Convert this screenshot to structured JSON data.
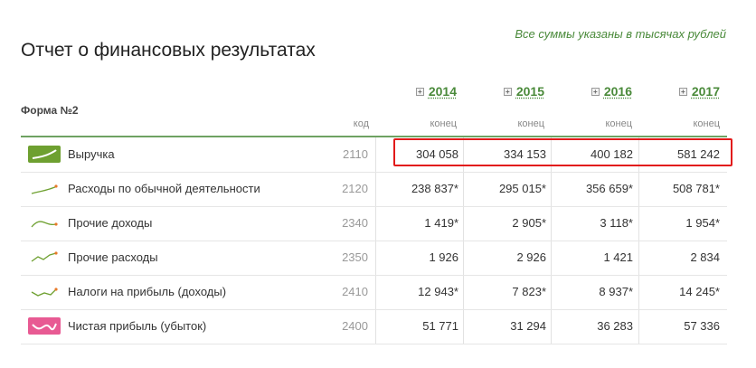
{
  "note": "Все суммы указаны в тысячах рублей",
  "title": "Отчет о финансовых результатах",
  "form_label": "Форма №2",
  "code_header": "код",
  "years": [
    {
      "label": "2014",
      "sub": "конец"
    },
    {
      "label": "2015",
      "sub": "конец"
    },
    {
      "label": "2016",
      "sub": "конец"
    },
    {
      "label": "2017",
      "sub": "конец"
    }
  ],
  "rows": [
    {
      "icon": "trend-chart-icon",
      "label": "Выручка",
      "code": "2110",
      "values": [
        "304 058",
        "334 153",
        "400 182",
        "581 242"
      ]
    },
    {
      "icon": "trend-line-icon",
      "label": "Расходы по обычной деятельности",
      "code": "2120",
      "values": [
        "238 837*",
        "295 015*",
        "356 659*",
        "508 781*"
      ]
    },
    {
      "icon": "trend-line-icon",
      "label": "Прочие доходы",
      "code": "2340",
      "values": [
        "1 419*",
        "2 905*",
        "3 118*",
        "1 954*"
      ]
    },
    {
      "icon": "trend-line-icon",
      "label": "Прочие расходы",
      "code": "2350",
      "values": [
        "1 926",
        "2 926",
        "1 421",
        "2 834"
      ]
    },
    {
      "icon": "trend-line-icon",
      "label": "Налоги на прибыль (доходы)",
      "code": "2410",
      "values": [
        "12 943*",
        "7 823*",
        "8 937*",
        "14 245*"
      ]
    },
    {
      "icon": "trend-chart-icon",
      "label": "Чистая прибыль (убыток)",
      "code": "2400",
      "values": [
        "51 771",
        "31 294",
        "36 283",
        "57 336"
      ]
    }
  ],
  "colors": {
    "accent": "#4a8a3a",
    "highlight": "#e21a1a",
    "net_profit": "#e85a93",
    "revenue": "#6ea030"
  }
}
